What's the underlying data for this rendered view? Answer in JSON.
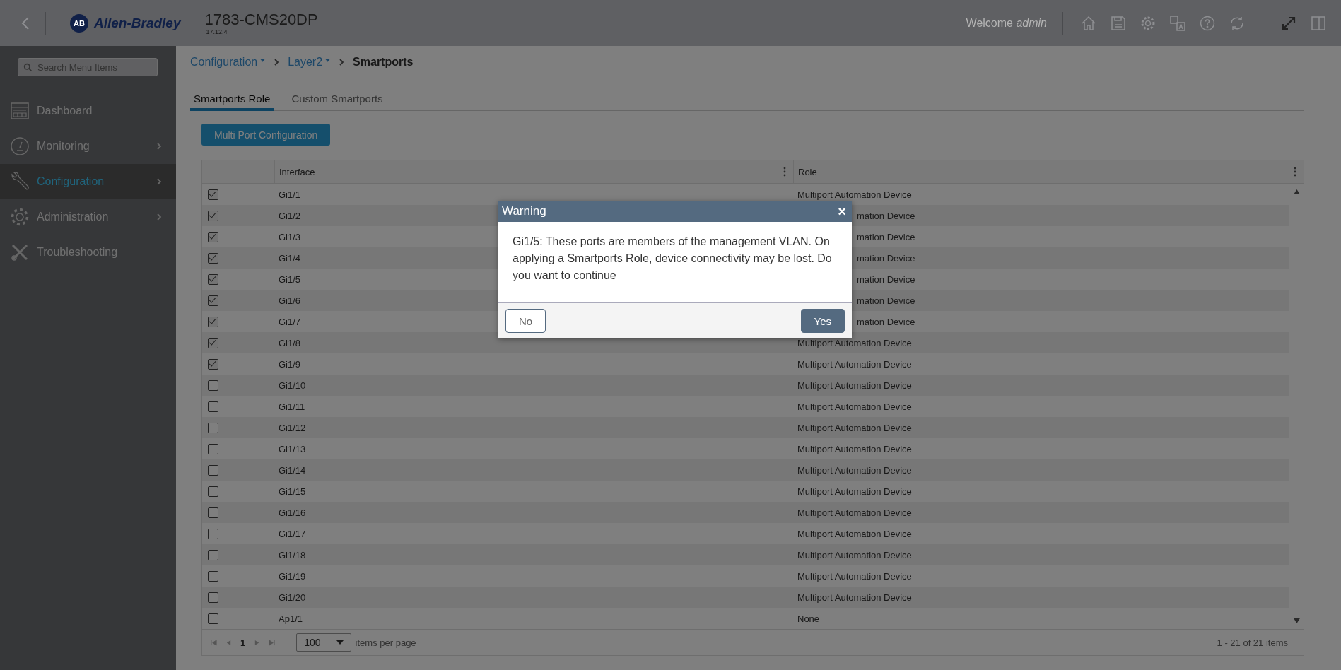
{
  "header": {
    "logo_mark": "AB",
    "brand": "Allen-Bradley",
    "device": "1783-CMS20DP",
    "version": "17.12.4",
    "welcome": "Welcome *admin*"
  },
  "sidebar": {
    "search_placeholder": "Search Menu Items",
    "items": [
      {
        "label": "Dashboard",
        "selected": false,
        "has_children": false
      },
      {
        "label": "Monitoring",
        "selected": false,
        "has_children": true
      },
      {
        "label": "Configuration",
        "selected": true,
        "has_children": true
      },
      {
        "label": "Administration",
        "selected": false,
        "has_children": true
      },
      {
        "label": "Troubleshooting",
        "selected": false,
        "has_children": false
      }
    ]
  },
  "breadcrumb": [
    {
      "label": "Configuration",
      "dropdown": true
    },
    {
      "label": "Layer2",
      "dropdown": true
    },
    {
      "label": "Smartports",
      "dropdown": false
    }
  ],
  "tabs": [
    {
      "label": "Smartports Role",
      "selected": true
    },
    {
      "label": "Custom Smartports",
      "selected": false
    }
  ],
  "action_button": "Multi Port Configuration",
  "table": {
    "columns": [
      "Interface",
      "Role"
    ],
    "rows": [
      {
        "checked": true,
        "interface": "Gi1/1",
        "role": "Multiport Automation Device"
      },
      {
        "checked": true,
        "interface": "Gi1/2",
        "role": "mation Device"
      },
      {
        "checked": true,
        "interface": "Gi1/3",
        "role": "mation Device"
      },
      {
        "checked": true,
        "interface": "Gi1/4",
        "role": "mation Device"
      },
      {
        "checked": true,
        "interface": "Gi1/5",
        "role": "mation Device"
      },
      {
        "checked": true,
        "interface": "Gi1/6",
        "role": "mation Device"
      },
      {
        "checked": true,
        "interface": "Gi1/7",
        "role": "mation Device"
      },
      {
        "checked": true,
        "interface": "Gi1/8",
        "role": "Multiport Automation Device"
      },
      {
        "checked": true,
        "interface": "Gi1/9",
        "role": "Multiport Automation Device"
      },
      {
        "checked": false,
        "interface": "Gi1/10",
        "role": "Multiport Automation Device"
      },
      {
        "checked": false,
        "interface": "Gi1/11",
        "role": "Multiport Automation Device"
      },
      {
        "checked": false,
        "interface": "Gi1/12",
        "role": "Multiport Automation Device"
      },
      {
        "checked": false,
        "interface": "Gi1/13",
        "role": "Multiport Automation Device"
      },
      {
        "checked": false,
        "interface": "Gi1/14",
        "role": "Multiport Automation Device"
      },
      {
        "checked": false,
        "interface": "Gi1/15",
        "role": "Multiport Automation Device"
      },
      {
        "checked": false,
        "interface": "Gi1/16",
        "role": "Multiport Automation Device"
      },
      {
        "checked": false,
        "interface": "Gi1/17",
        "role": "Multiport Automation Device"
      },
      {
        "checked": false,
        "interface": "Gi1/18",
        "role": "Multiport Automation Device"
      },
      {
        "checked": false,
        "interface": "Gi1/19",
        "role": "Multiport Automation Device"
      },
      {
        "checked": false,
        "interface": "Gi1/20",
        "role": "Multiport Automation Device"
      },
      {
        "checked": false,
        "interface": "Ap1/1",
        "role": "None"
      }
    ]
  },
  "pagination": {
    "page": "1",
    "page_size": "100",
    "page_size_label": "items per page",
    "summary": "1 - 21 of 21 items"
  },
  "dialog": {
    "title": "Warning",
    "close": "×",
    "message": "Gi1/5: These ports are members of the management VLAN. On applying a Smartports Role, device connectivity may be lost. Do you want to continue",
    "buttons": [
      {
        "label": "No",
        "kind": "secondary"
      },
      {
        "label": "Yes",
        "kind": "primary"
      }
    ]
  }
}
